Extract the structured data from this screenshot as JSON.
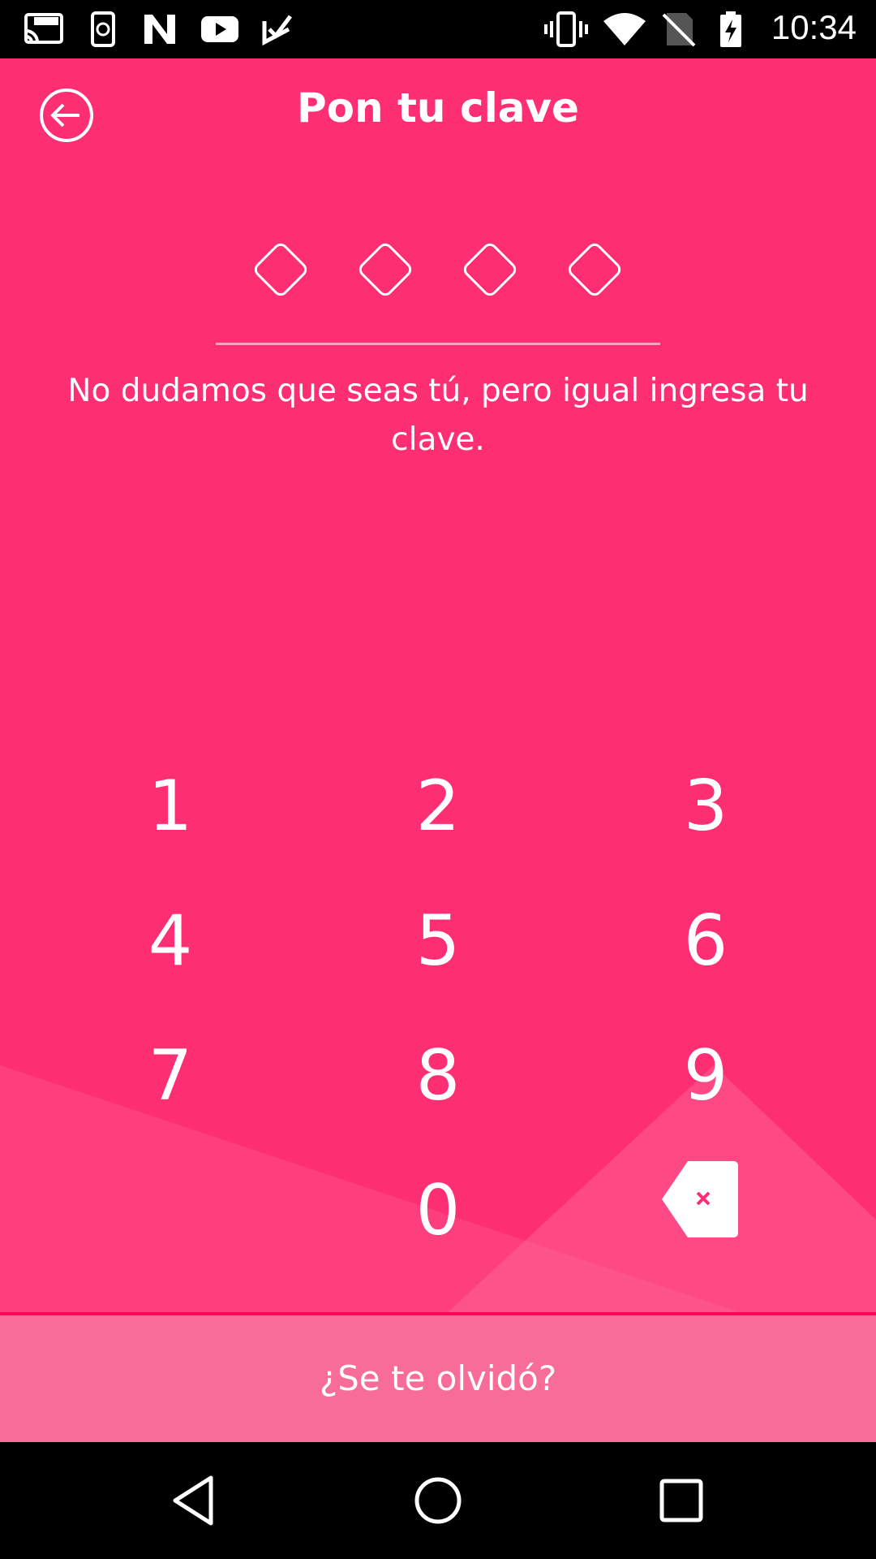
{
  "status_bar": {
    "time": "10:34",
    "left_icons": [
      "cast-http-icon",
      "phone-sync-icon",
      "n-logo-icon",
      "youtube-icon",
      "checkmark-app-icon"
    ],
    "right_icons": [
      "vibrate-icon",
      "wifi-icon",
      "no-sim-icon",
      "battery-charging-icon"
    ]
  },
  "header": {
    "title": "Pon tu clave",
    "back_icon": "back-arrow-circle-icon"
  },
  "pin": {
    "slots_total": 4,
    "slots_filled": 0,
    "instructions": "No dudamos que seas tú, pero igual ingresa tu clave."
  },
  "keypad": {
    "keys": [
      "1",
      "2",
      "3",
      "4",
      "5",
      "6",
      "7",
      "8",
      "9",
      "0"
    ],
    "backspace_icon": "backspace-icon"
  },
  "footer": {
    "forgot_label": "¿Se te olvidó?"
  },
  "colors": {
    "background": "#fd2e72",
    "footer": "#f86c98",
    "accent_line": "#f50a5a",
    "text": "#ffffff"
  },
  "nav_bar": {
    "buttons": [
      "back-triangle-icon",
      "home-circle-icon",
      "recents-square-icon"
    ]
  }
}
